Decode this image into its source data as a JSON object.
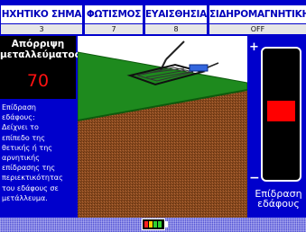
{
  "settings": [
    {
      "label": "ΗΧΗΤΙΚΟ ΣΗΜΑ",
      "value": "3"
    },
    {
      "label": "ΦΩΤΙΣΜΟΣ",
      "value": "7"
    },
    {
      "label": "ΕΥΑΙΣΘΗΣΙΑ",
      "value": "8"
    },
    {
      "label": "ΣΙΔΗΡΟΜΑΓΝΗΤΙΚΗ",
      "value": "OFF"
    }
  ],
  "rejection": {
    "title_line1": "Απόρριψη",
    "title_line2": "μεταλλεύματος",
    "value": "70"
  },
  "info": {
    "lines": [
      "Επίδραση",
      "εδάφους:",
      "Δείχνει το",
      "επίπεδο της",
      "θετικής ή της",
      "αρνητικής",
      "επίδρασης της",
      "περιεκτικότητας",
      "του εδάφους σε",
      "μετάλλευμα."
    ]
  },
  "ground_gauge": {
    "plus": "+",
    "minus": "−",
    "label_line1": "Επίδραση",
    "label_line2": "εδάφους",
    "marker_color": "#ff0000"
  },
  "battery": {
    "cells": [
      "#ff2020",
      "#ffd000",
      "#30d030",
      "#30d030"
    ]
  },
  "colors": {
    "background": "#0000cc",
    "grass": "#1e8a1e",
    "soil": "#8b4a1e"
  }
}
